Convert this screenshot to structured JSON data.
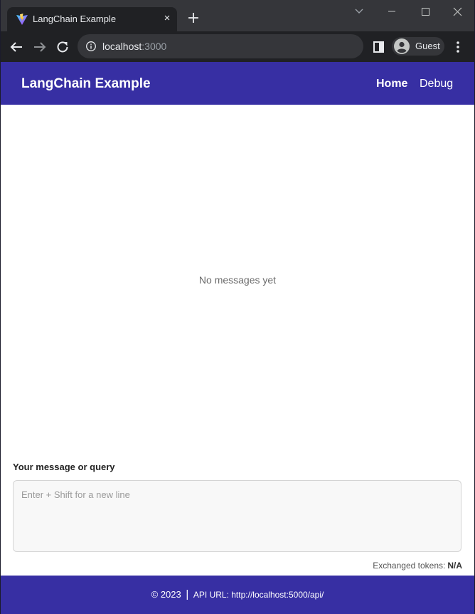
{
  "browser": {
    "tab_title": "LangChain Example",
    "new_tab_symbol": "+",
    "close_symbol": "×",
    "url_host": "localhost",
    "url_port": ":3000",
    "profile_label": "Guest"
  },
  "header": {
    "title": "LangChain Example",
    "nav": {
      "home": "Home",
      "debug": "Debug"
    }
  },
  "main": {
    "empty_message": "No messages yet",
    "input_label": "Your message or query",
    "input_placeholder": "Enter + Shift for a new line",
    "input_value": "",
    "tokens_label": "Exchanged tokens:",
    "tokens_value": "N/A"
  },
  "footer": {
    "copyright": "© 2023",
    "separator": "|",
    "api_url": "API URL: http://localhost:5000/api/"
  },
  "colors": {
    "brand": "#372fa3",
    "browser_frame": "#35363a",
    "browser_toolbar": "#202124"
  },
  "icons": {
    "favicon": "vite-logo-icon",
    "back": "arrow-left-icon",
    "forward": "arrow-right-icon",
    "reload": "reload-icon",
    "info": "info-icon",
    "side_panel": "side-panel-icon",
    "profile": "person-icon",
    "menu": "kebab-menu-icon"
  }
}
